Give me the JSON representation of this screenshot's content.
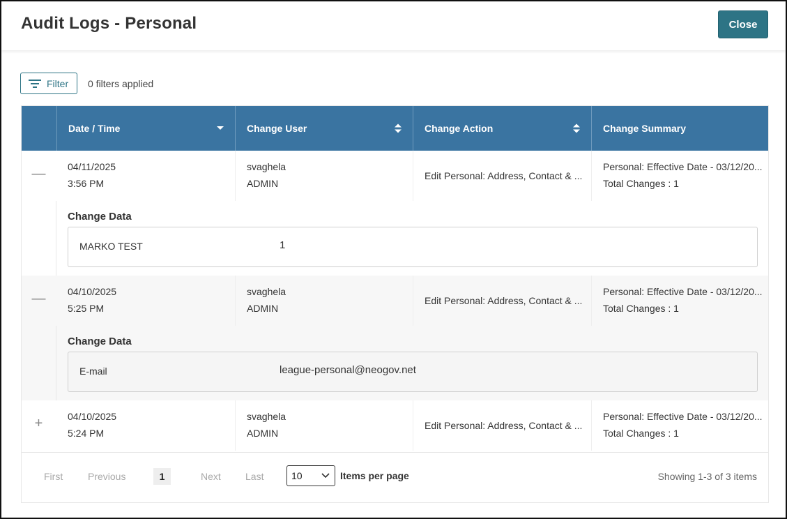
{
  "header": {
    "title": "Audit Logs - Personal",
    "close_label": "Close"
  },
  "toolbar": {
    "filter_label": "Filter",
    "filters_applied": "0 filters applied"
  },
  "table": {
    "columns": [
      {
        "label": "Date / Time",
        "sort": "desc"
      },
      {
        "label": "Change User",
        "sort": "both"
      },
      {
        "label": "Change Action",
        "sort": "both"
      },
      {
        "label": "Change Summary",
        "sort": "none"
      }
    ],
    "rows": [
      {
        "expander": "—",
        "date": "04/11/2025",
        "time": "3:56 PM",
        "user": "svaghela",
        "role": "ADMIN",
        "action": "Edit Personal: Address, Contact & ...",
        "summary_line1": "Personal: Effective Date - 03/12/20...",
        "summary_line2": "Total Changes : 1",
        "expanded": true,
        "detail_title": "Change Data",
        "detail_key": "MARKO TEST",
        "detail_value": "1"
      },
      {
        "expander": "—",
        "date": "04/10/2025",
        "time": "5:25 PM",
        "user": "svaghela",
        "role": "ADMIN",
        "action": "Edit Personal: Address, Contact & ...",
        "summary_line1": "Personal: Effective Date - 03/12/20...",
        "summary_line2": "Total Changes : 1",
        "expanded": true,
        "detail_title": "Change Data",
        "detail_key": "E-mail",
        "detail_value": "league-personal@neogov.net"
      },
      {
        "expander": "+",
        "date": "04/10/2025",
        "time": "5:24 PM",
        "user": "svaghela",
        "role": "ADMIN",
        "action": "Edit Personal: Address, Contact & ...",
        "summary_line1": "Personal: Effective Date - 03/12/20...",
        "summary_line2": "Total Changes : 1",
        "expanded": false
      }
    ]
  },
  "pager": {
    "first": "First",
    "previous": "Previous",
    "current_page": "1",
    "next": "Next",
    "last": "Last",
    "per_page_value": "10",
    "per_page_label": "Items per page",
    "showing": "Showing 1-3 of 3 items"
  },
  "colors": {
    "accent": "#2d7485",
    "header_blue": "#3a74a1"
  }
}
